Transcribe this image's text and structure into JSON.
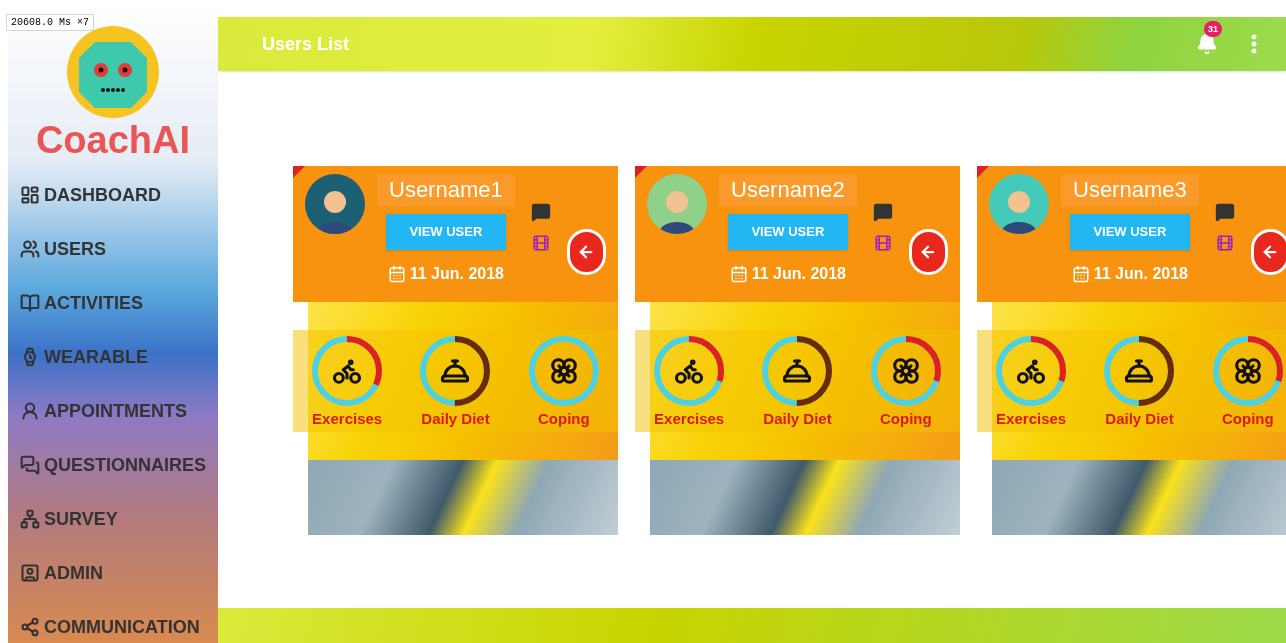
{
  "debug_overlay": "20608.0 Ms ×7",
  "brand": "CoachAI",
  "nav": [
    {
      "label": "DASHBOARD"
    },
    {
      "label": "USERS"
    },
    {
      "label": "ACTIVITIES"
    },
    {
      "label": "WEARABLE"
    },
    {
      "label": "APPOINTMENTS"
    },
    {
      "label": "QUESTIONNAIRES"
    },
    {
      "label": "SURVEY"
    },
    {
      "label": "ADMIN"
    },
    {
      "label": "COMMUNICATION"
    }
  ],
  "header": {
    "title": "Users List",
    "notifications": "31"
  },
  "users": [
    {
      "name": "Username1",
      "button": "VIEW USER",
      "date": "11 Jun. 2018",
      "stats": [
        {
          "kind": "exercise",
          "label": "Exercises",
          "level": 0.32
        },
        {
          "kind": "diet",
          "label": "Daily Diet",
          "level": 0.5
        },
        {
          "kind": "coping",
          "label": "Coping",
          "level": 0
        }
      ]
    },
    {
      "name": "Username2",
      "button": "VIEW USER",
      "date": "11 Jun. 2018",
      "stats": [
        {
          "kind": "exercise",
          "label": "Exercises",
          "level": 0.3
        },
        {
          "kind": "diet",
          "label": "Daily Diet",
          "level": 0.5
        },
        {
          "kind": "coping",
          "label": "Coping",
          "level": 0.3
        }
      ]
    },
    {
      "name": "Username3",
      "button": "VIEW USER",
      "date": "11 Jun. 2018",
      "stats": [
        {
          "kind": "exercise",
          "label": "Exercises",
          "level": 0.3
        },
        {
          "kind": "diet",
          "label": "Daily Diet",
          "level": 0.5
        },
        {
          "kind": "coping",
          "label": "Coping",
          "level": 0.3
        }
      ]
    }
  ]
}
